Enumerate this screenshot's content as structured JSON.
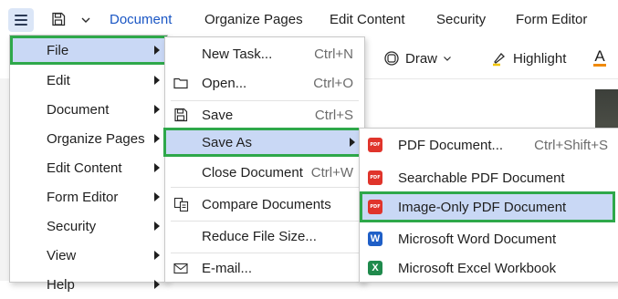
{
  "tabbar": {
    "tabs": [
      {
        "label": "Document",
        "active": true
      },
      {
        "label": "Organize Pages"
      },
      {
        "label": "Edit Content"
      },
      {
        "label": "Security"
      },
      {
        "label": "Form Editor"
      }
    ]
  },
  "toolbar": {
    "draw_label": "Draw",
    "highlight_label": "Highlight",
    "text_color_glyph": "A"
  },
  "menu1": {
    "items": [
      {
        "label": "File",
        "has_submenu": true
      },
      {
        "label": "Edit",
        "has_submenu": true
      },
      {
        "label": "Document",
        "has_submenu": true
      },
      {
        "label": "Organize Pages",
        "has_submenu": true
      },
      {
        "label": "Edit Content",
        "has_submenu": true
      },
      {
        "label": "Form Editor",
        "has_submenu": true
      },
      {
        "label": "Security",
        "has_submenu": true
      },
      {
        "label": "View",
        "has_submenu": true
      },
      {
        "label": "Help",
        "has_submenu": true
      }
    ]
  },
  "menu2": {
    "items": [
      {
        "label": "New Task...",
        "shortcut": "Ctrl+N"
      },
      {
        "label": "Open...",
        "shortcut": "Ctrl+O"
      },
      {
        "label": "Save",
        "shortcut": "Ctrl+S"
      },
      {
        "label": "Save As",
        "has_submenu": true
      },
      {
        "label": "Close Document",
        "shortcut": "Ctrl+W"
      },
      {
        "label": "Compare Documents"
      },
      {
        "label": "Reduce File Size..."
      },
      {
        "label": "E-mail..."
      }
    ]
  },
  "menu3": {
    "items": [
      {
        "label": "PDF Document...",
        "shortcut": "Ctrl+Shift+S",
        "icon": "pdf-icon"
      },
      {
        "label": "Searchable PDF Document",
        "icon": "pdf-icon"
      },
      {
        "label": "Image-Only PDF Document",
        "icon": "pdf-icon"
      },
      {
        "label": "Microsoft Word Document",
        "icon": "word-icon"
      },
      {
        "label": "Microsoft Excel Workbook",
        "icon": "excel-icon"
      }
    ],
    "pdf_badge": "PDF",
    "word_badge": "W",
    "excel_badge": "X"
  },
  "colors": {
    "accent": "#1a56c4",
    "highlight_bg": "#c9d8f5",
    "selection_box": "#2ea84a",
    "pdf_red": "#e0342b",
    "word_blue": "#1f5fc7",
    "excel_green": "#1f8a4c"
  }
}
